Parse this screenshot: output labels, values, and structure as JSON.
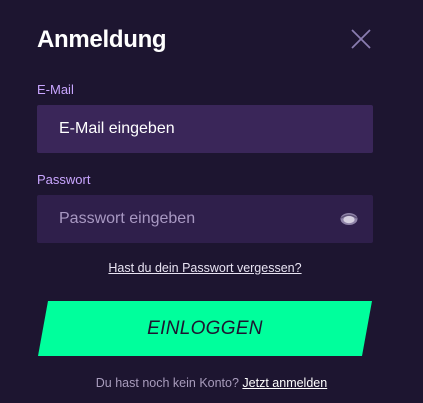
{
  "dialog": {
    "title": "Anmeldung",
    "close_icon": "close-icon"
  },
  "email": {
    "label": "E-Mail",
    "placeholder": "E-Mail eingeben",
    "value": ""
  },
  "password": {
    "label": "Passwort",
    "placeholder": "Passwort eingeben",
    "value": "",
    "toggle_icon": "eye-icon"
  },
  "forgot_link": "Hast du dein Passwort vergessen?",
  "login_button": "EINLOGGEN",
  "signup": {
    "prompt": "Du hast noch kein Konto?",
    "link": "Jetzt anmelden"
  },
  "colors": {
    "background": "#1d1530",
    "accent": "#00ff9c",
    "label": "#c9a6ff",
    "field_active": "#3a2659",
    "field": "#2f1f4b"
  }
}
